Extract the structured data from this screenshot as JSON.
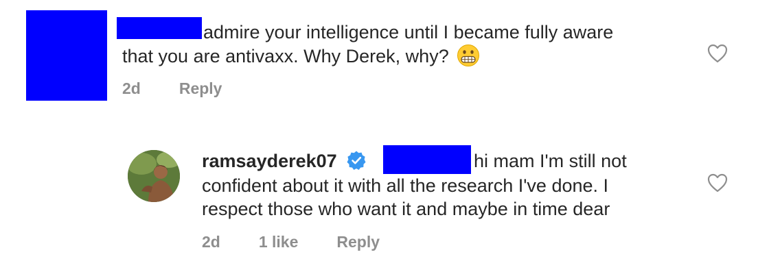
{
  "comment": {
    "line1": "admire your intelligence until I became fully aware",
    "line2": "that you are antivaxx. Why Derek, why?",
    "emoji": "grimacing-face-emoji",
    "time": "2d",
    "reply_label": "Reply"
  },
  "reply": {
    "username": "ramsayderek07",
    "line1_text": "hi mam I'm still not",
    "line2": "confident about it with all the research I've done. I",
    "line3": "respect those who want it and maybe in time dear",
    "time": "2d",
    "likes": "1 like",
    "reply_label": "Reply"
  },
  "colors": {
    "redaction": "#0000ff",
    "text": "#262626",
    "meta": "#8e8e8e",
    "verified": "#3897f0"
  },
  "icons": {
    "like": "heart-outline-icon",
    "verified": "verified-badge-icon"
  }
}
